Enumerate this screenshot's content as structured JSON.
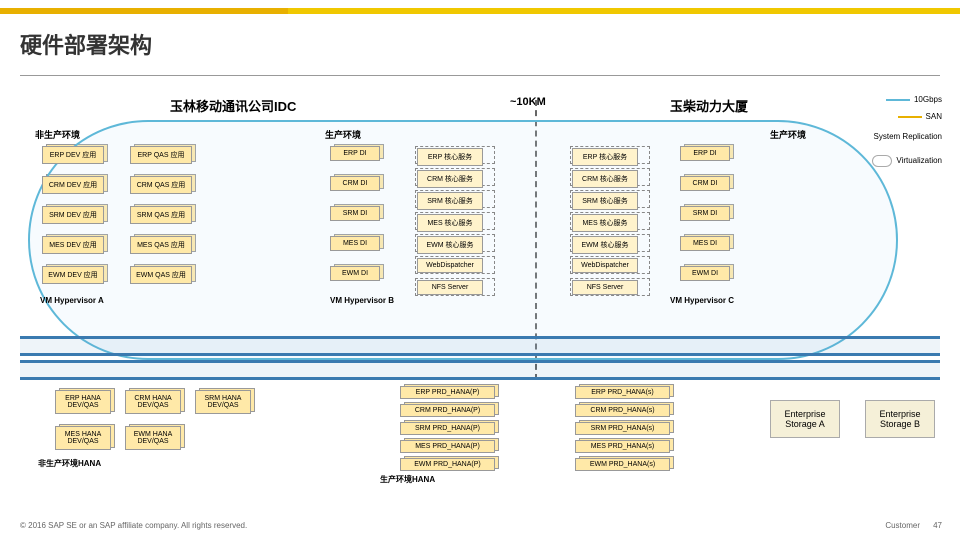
{
  "header": {
    "title": "硬件部署架构"
  },
  "dc": {
    "idc": "玉林移动通讯公司IDC",
    "distance": "~10KM",
    "building": "玉柴动力大厦"
  },
  "env": {
    "nonprod": "非生产环境",
    "prodA": "生产环境",
    "prodB": "生产环境"
  },
  "np": {
    "c1": [
      "ERP DEV 应用",
      "CRM DEV 应用",
      "SRM DEV 应用",
      "MES DEV 应用",
      "EWM DEV 应用"
    ],
    "c2": [
      "ERP QAS 应用",
      "CRM QAS 应用",
      "SRM QAS 应用",
      "MES QAS 应用",
      "EWM QAS 应用"
    ]
  },
  "pa": {
    "di": [
      "ERP DI",
      "CRM DI",
      "SRM DI",
      "MES DI",
      "EWM DI"
    ],
    "svc": [
      "ERP 核心服务",
      "CRM 核心服务",
      "SRM 核心服务",
      "MES 核心服务",
      "EWM 核心服务",
      "WebDispatcher",
      "NFS Server"
    ]
  },
  "pb": {
    "svc": [
      "ERP 核心服务",
      "CRM 核心服务",
      "SRM 核心服务",
      "MES 核心服务",
      "EWM 核心服务",
      "WebDispatcher",
      "NFS Server"
    ],
    "di": [
      "ERP DI",
      "CRM DI",
      "SRM DI",
      "MES DI",
      "EWM DI"
    ]
  },
  "hyp": {
    "a": "VM Hypervisor A",
    "b": "VM Hypervisor B",
    "c": "VM Hypervisor C"
  },
  "hana": {
    "np": [
      "ERP HANA DEV/QAS",
      "CRM HANA DEV/QAS",
      "SRM HANA DEV/QAS",
      "MES HANA DEV/QAS",
      "EWM HANA DEV/QAS"
    ],
    "nplabel": "非生产环境HANA",
    "p1": [
      "ERP PRD_HANA(P)",
      "CRM PRD_HANA(P)",
      "SRM PRD_HANA(P)",
      "MES PRD_HANA(P)",
      "EWM PRD_HANA(P)"
    ],
    "p2": [
      "ERP PRD_HANA(s)",
      "CRM PRD_HANA(s)",
      "SRM PRD_HANA(s)",
      "MES PRD_HANA(s)",
      "EWM PRD_HANA(s)"
    ],
    "plabel": "生产环境HANA"
  },
  "storage": {
    "a": "Enterprise Storage A",
    "b": "Enterprise Storage B"
  },
  "legend": {
    "l1": "10Gbps",
    "l2": "SAN",
    "l3": "System Replication",
    "l4": "Virtualization"
  },
  "footer": {
    "copy": "© 2016 SAP SE or an SAP affiliate company. All rights reserved.",
    "cust": "Customer",
    "page": "47"
  }
}
